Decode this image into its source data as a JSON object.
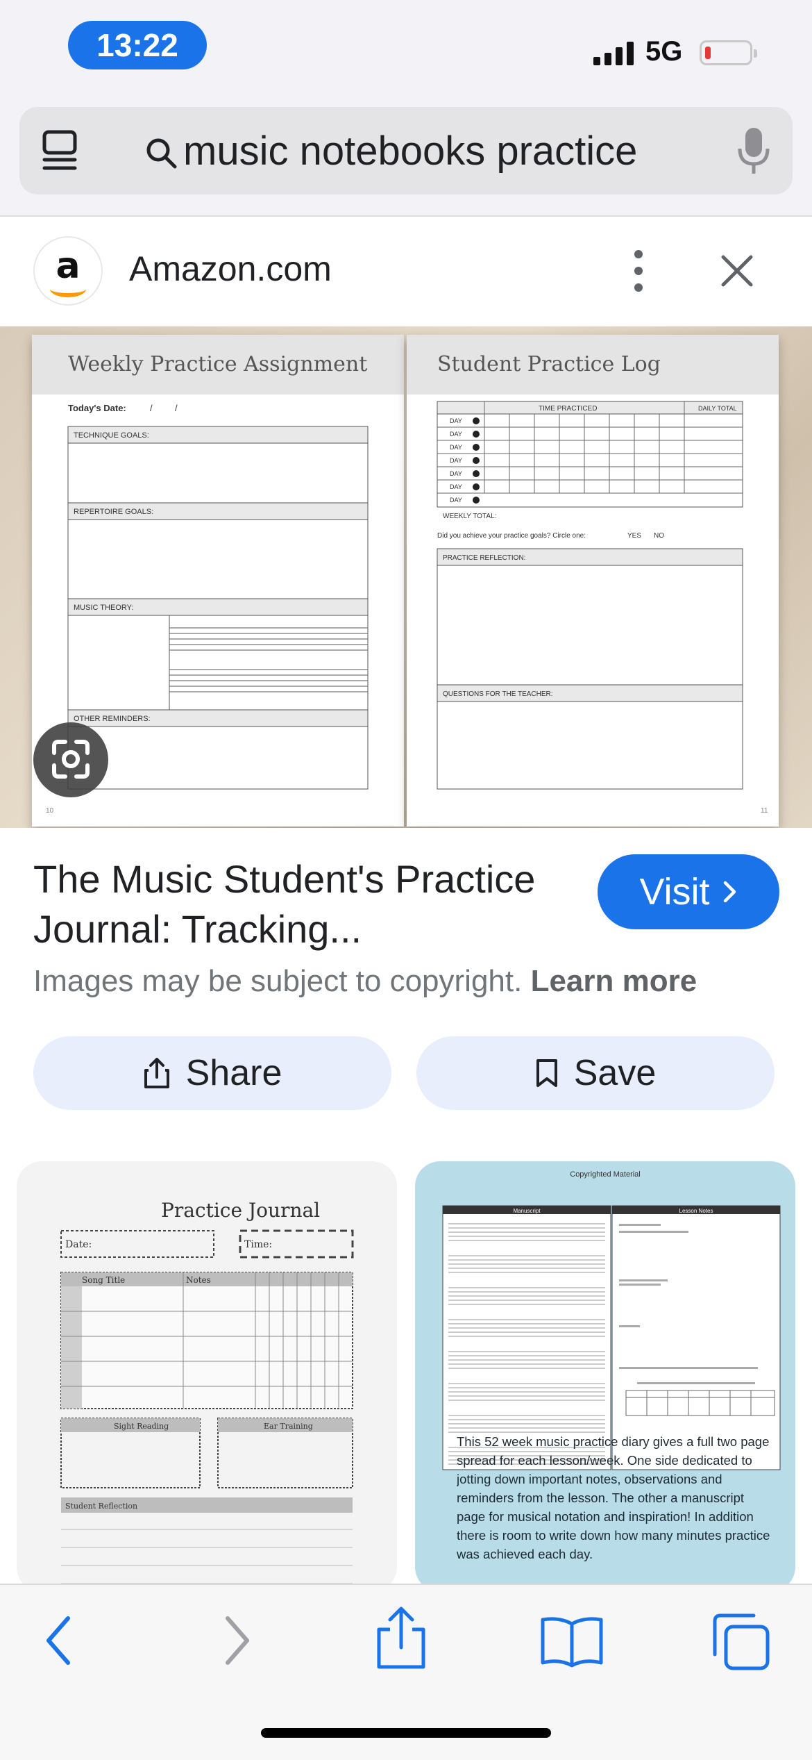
{
  "status_bar": {
    "time": "13:22",
    "network": "5G"
  },
  "search": {
    "query": "music notebooks practice"
  },
  "source": {
    "name": "Amazon.com",
    "logo_letter": "a"
  },
  "hero": {
    "left_page_title": "Weekly Practice Assignment",
    "right_page_title": "Student Practice Log",
    "left_fields": {
      "date": "Today's Date:",
      "technique": "TECHNIQUE GOALS:",
      "repertoire": "REPERTOIRE GOALS:",
      "theory": "MUSIC THEORY:",
      "reminders": "OTHER REMINDERS:"
    },
    "right_fields": {
      "time_practiced": "TIME PRACTICED",
      "daily_total": "DAILY TOTAL",
      "day": "DAY",
      "weekly_total": "WEEKLY TOTAL:",
      "goals_question": "Did you achieve your practice goals? Circle one:",
      "yes": "YES",
      "no": "NO",
      "reflection": "PRACTICE REFLECTION:",
      "questions": "QUESTIONS FOR THE TEACHER:"
    },
    "footer_left": "10",
    "footer_right": "11"
  },
  "result": {
    "title": "The Music Student's Practice Journal: Tracking...",
    "visit_label": "Visit",
    "copyright_text": "Images may be subject to copyright.",
    "learn_more": "Learn more",
    "share_label": "Share",
    "save_label": "Save"
  },
  "related": {
    "card1_title": "Practice Journal",
    "card1_fields": {
      "date": "Date:",
      "time": "Time:",
      "song_title": "Song Title",
      "notes": "Notes",
      "sight_reading": "Sight Reading",
      "ear_training": "Ear Training",
      "reflection": "Student Reflection"
    },
    "card2_header": "Copyrighted Material",
    "card2_manuscript": "Manuscript",
    "card2_lesson_notes": "Lesson Notes",
    "card2_text": "This 52 week music practice diary gives a full two page spread for each lesson/week. One side dedicated to jotting down important notes, observations and reminders from the lesson. The other a manuscript page for musical notation and inspiration! In addition there is room to write down how many minutes practice was achieved each day."
  },
  "icons": [
    "tabs-icon",
    "search-icon",
    "microphone-icon",
    "more-vert-icon",
    "close-icon",
    "google-lens-icon",
    "share-icon",
    "bookmark-icon",
    "chevron-right-icon",
    "back-icon",
    "forward-icon",
    "share-sheet-icon",
    "bookmarks-icon",
    "tabs-overview-icon"
  ],
  "colors": {
    "accent": "#1a73e8",
    "pill_bg": "#e8eefb",
    "chrome_bg": "#f2f2f7",
    "card2_bg": "#b9dde8"
  }
}
